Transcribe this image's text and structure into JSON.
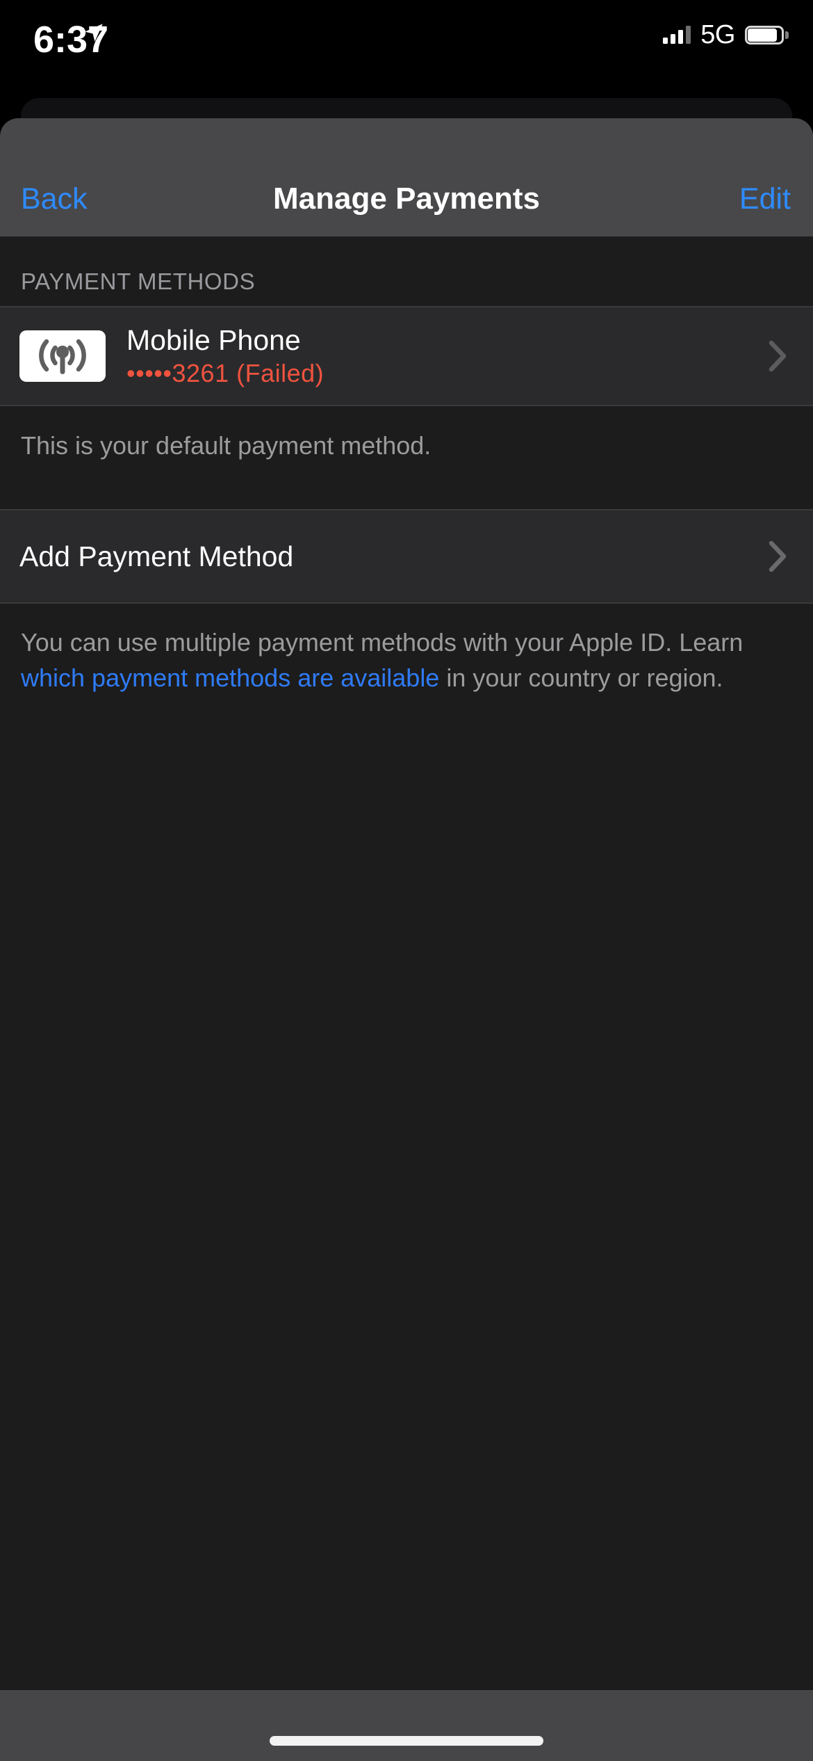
{
  "status_bar": {
    "time": "6:37",
    "location_icon": "location-arrow-icon",
    "signal_icon": "cellular-signal-icon",
    "signal_bars": 3,
    "network": "5G",
    "battery_icon": "battery-icon",
    "battery_level_percent": 78
  },
  "nav": {
    "back_label": "Back",
    "title": "Manage Payments",
    "edit_label": "Edit"
  },
  "sections": {
    "payment_methods": {
      "header": "PAYMENT METHODS",
      "rows": [
        {
          "icon": "broadcast-antenna-icon",
          "title": "Mobile Phone",
          "detail": "•••••3261 (Failed)",
          "detail_color": "#f0533f",
          "chevron": "chevron-right-icon"
        }
      ],
      "footer": "This is your default payment method."
    },
    "add_payment": {
      "label": "Add Payment Method",
      "chevron": "chevron-right-icon"
    },
    "info_footer": {
      "text_before": "You can use multiple payment methods with your Apple ID. Learn ",
      "link_text": "which payment methods are available",
      "text_after": " in your country or region."
    }
  },
  "colors": {
    "accent_blue": "#2f8bff",
    "link_blue": "#2f7bf6",
    "error_red": "#f0533f",
    "nav_background": "#48484a",
    "sheet_background": "#1c1c1c",
    "row_background": "#2a2a2c",
    "secondary_text": "#9c9c9e"
  },
  "home_indicator": "home-indicator"
}
